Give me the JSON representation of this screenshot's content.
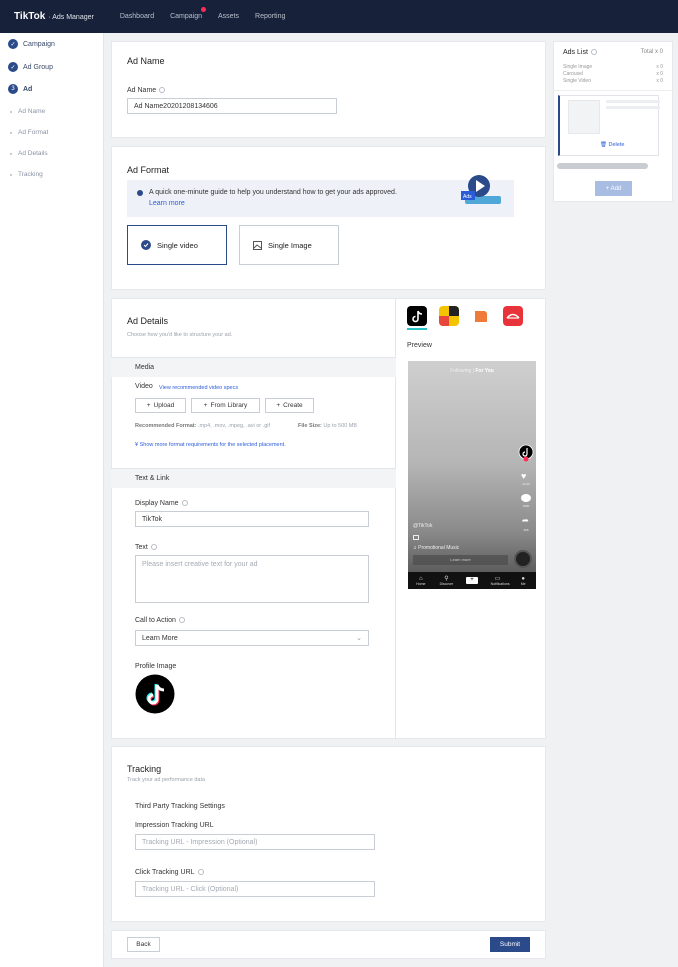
{
  "topbar": {
    "brand": "TikTok",
    "brand_sub": "Ads Manager",
    "nav": [
      "Dashboard",
      "Campaign",
      "Assets",
      "Reporting"
    ]
  },
  "sidebar": {
    "steps": [
      {
        "label": "Campaign",
        "state": "done"
      },
      {
        "label": "Ad Group",
        "state": "done"
      },
      {
        "label": "Ad",
        "state": "current",
        "number": "3"
      }
    ],
    "sub_steps": [
      "Ad Name",
      "Ad Format",
      "Ad Details",
      "Tracking"
    ]
  },
  "ad_name": {
    "title": "Ad Name",
    "label": "Ad Name",
    "value": "Ad Name20201208134606"
  },
  "ad_format": {
    "title": "Ad Format",
    "tip": "A quick one-minute guide to help you understand how to get your ads approved.",
    "learn_more": "Learn more",
    "options": [
      "Single video",
      "Single Image"
    ],
    "selected": "Single video"
  },
  "ad_details": {
    "title": "Ad Details",
    "subtitle": "Choose how you'd like to structure your ad.",
    "media_section": "Media",
    "video_label": "Video",
    "video_specs_link": "View recommended video specs",
    "buttons": [
      "Upload",
      "From Library",
      "Create"
    ],
    "recommended_format_label": "Recommended Format:",
    "recommended_format_value": ".mp4, .mov, .mpeg, .avi or .gif",
    "file_size_label": "File Size:",
    "file_size_value": "Up to 500 MB",
    "show_more": "Show more format requirements for the selected placement.",
    "text_link_section": "Text & Link",
    "display_name_label": "Display Name",
    "display_name_value": "TikTok",
    "text_label": "Text",
    "text_placeholder": "Please insert creative text for your ad",
    "cta_label": "Call to Action",
    "cta_value": "Learn More",
    "profile_image_label": "Profile Image"
  },
  "preview": {
    "label": "Preview",
    "feed_following": "Following",
    "feed_foryou": "For You",
    "handle": "@TikTok",
    "music": "Promotional Music",
    "cta": "Learn more",
    "counts": [
      "23.4k",
      "7890",
      "456"
    ],
    "tabs": [
      "Home",
      "Discover",
      "",
      "Notifications",
      "Me"
    ]
  },
  "tracking": {
    "title": "Tracking",
    "subtitle": "Track your ad performance data",
    "section": "Third Party Tracking Settings",
    "impression_label": "Impression Tracking URL",
    "impression_placeholder": "Tracking URL - Impression (Optional)",
    "click_label": "Click Tracking URL",
    "click_placeholder": "Tracking URL - Click (Optional)"
  },
  "footer": {
    "back": "Back",
    "submit": "Submit"
  },
  "ads_list": {
    "title": "Ads List",
    "total": "Total x 0",
    "rows": [
      {
        "label": "Single Image",
        "count": "x 0"
      },
      {
        "label": "Carousel",
        "count": "x 0"
      },
      {
        "label": "Single Video",
        "count": "x 0"
      }
    ],
    "delete": "Delete",
    "add": "+ Add"
  },
  "colors": {
    "navy": "#17213a",
    "primary": "#2b4a8a",
    "link": "#2b5cd8",
    "tiktok_red": "#fe2c55"
  }
}
